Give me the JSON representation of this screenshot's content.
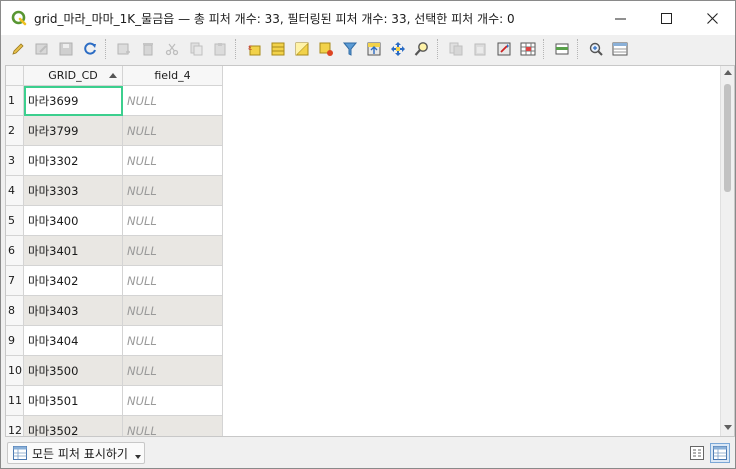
{
  "window": {
    "title": "grid_마라_마마_1K_물금읍 — 총 피처 개수: 33, 필터링된 피처 개수: 33, 선택한 피처 개수: 0"
  },
  "toolbar": {
    "icons": [
      "pencil-edit-icon",
      "multi-edit-icon",
      "save-edits-icon",
      "reload-icon",
      "add-feature-icon",
      "delete-feature-icon",
      "cut-icon",
      "copy-icon",
      "paste-icon",
      "select-by-expression-icon",
      "select-all-icon",
      "invert-selection-icon",
      "deselect-all-icon",
      "filter-select-icon",
      "move-selection-top-icon",
      "pan-to-selection-icon",
      "zoom-to-selection-icon",
      "new-field-icon",
      "delete-field-icon",
      "field-calculator-icon",
      "conditional-formatting-icon",
      "dock-icon",
      "actions-icon",
      "dock-attribute-table-icon"
    ]
  },
  "table": {
    "columns": [
      "GRID_CD",
      "field_4"
    ],
    "rows": [
      {
        "num": "1",
        "grid_cd": "마라3699",
        "field_4": "NULL"
      },
      {
        "num": "2",
        "grid_cd": "마라3799",
        "field_4": "NULL"
      },
      {
        "num": "3",
        "grid_cd": "마마3302",
        "field_4": "NULL"
      },
      {
        "num": "4",
        "grid_cd": "마마3303",
        "field_4": "NULL"
      },
      {
        "num": "5",
        "grid_cd": "마마3400",
        "field_4": "NULL"
      },
      {
        "num": "6",
        "grid_cd": "마마3401",
        "field_4": "NULL"
      },
      {
        "num": "7",
        "grid_cd": "마마3402",
        "field_4": "NULL"
      },
      {
        "num": "8",
        "grid_cd": "마마3403",
        "field_4": "NULL"
      },
      {
        "num": "9",
        "grid_cd": "마마3404",
        "field_4": "NULL"
      },
      {
        "num": "10",
        "grid_cd": "마마3500",
        "field_4": "NULL"
      },
      {
        "num": "11",
        "grid_cd": "마마3501",
        "field_4": "NULL"
      },
      {
        "num": "12",
        "grid_cd": "마마3502",
        "field_4": "NULL"
      }
    ]
  },
  "bottombar": {
    "filter_label": "모든 피처 표시하기"
  },
  "colors": {
    "selection_outline": "#3ccf8e",
    "alt_row": "#e9e7e3",
    "qgis_green": "#589632"
  }
}
